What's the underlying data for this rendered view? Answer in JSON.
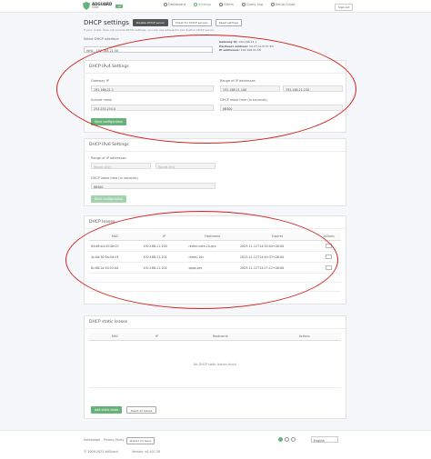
{
  "header": {
    "logo_name": "ADGUARD",
    "logo_sub": "HOME",
    "logo_badge": "v0",
    "nav": [
      {
        "label": "Dashboard",
        "active": false
      },
      {
        "label": "Settings",
        "active": true
      },
      {
        "label": "Filters",
        "active": false
      },
      {
        "label": "Query Log",
        "active": false
      },
      {
        "label": "Setup Guide",
        "active": false
      }
    ],
    "sign_out": "Sign out"
  },
  "page": {
    "title": "DHCP settings",
    "btn_disable": "Disable DHCP server",
    "btn_check": "Check for DHCP servers",
    "btn_reset": "Reset settings",
    "hint": "If your router does not provide DHCP settings, you can use AdGuard's own built-in DHCP server."
  },
  "interface": {
    "label": "Select DHCP interface",
    "selected": "eth0 - 192.168.21.58",
    "gateway_label": "Gateway IP:",
    "gateway_value": "192.168.21.1",
    "hw_label": "Hardware address:",
    "hw_value": "5d:27:ce:57:fc:63",
    "ip_label": "IP addresses:",
    "ip_value": "192.168.21.58"
  },
  "ipv4": {
    "title": "DHCP IPv4 Settings",
    "gateway_label": "Gateway IP",
    "gateway_value": "192.168.21.1",
    "range_label": "Range of IP addresses",
    "range_start": "192.168.21.100",
    "range_end": "192.168.21.230",
    "mask_label": "Subnet mask",
    "mask_value": "255.255.255.0",
    "lease_label": "DHCP lease time (in seconds)",
    "lease_value": "86400",
    "save": "Save configuration"
  },
  "ipv6": {
    "title": "DHCP IPv6 Settings",
    "range_label": "Range of IP addresses",
    "range_start_ph": "Range start",
    "range_end_ph": "Range end",
    "lease_label": "DHCP lease time (in seconds)",
    "lease_value": "86400",
    "save": "Save configuration"
  },
  "leases": {
    "title": "DHCP leases",
    "columns": [
      "MAC",
      "IP",
      "Hostname",
      "Expires",
      "Actions"
    ],
    "rows": [
      {
        "mac": "84:d8:b4:45:0b:07",
        "ip": "192.168.21.100",
        "host": "redmi-note-10-pro",
        "expires": "2023-11-12T14:30:04+08:00"
      },
      {
        "mac": "4c:0d:30:5a:5d:43",
        "ip": "192.168.21.101",
        "host": "redmi-10c",
        "expires": "2023-11-12T14:49:37+08:00"
      },
      {
        "mac": "8c:88:2a:50:52:00",
        "ip": "192.168.21.102",
        "host": "oppo-pro",
        "expires": "2023-11-12T14:27:12+08:00"
      }
    ]
  },
  "static": {
    "title": "DHCP static leases",
    "columns": [
      "MAC",
      "IP",
      "Hostname",
      "Actions"
    ],
    "empty": "No DHCP static leases found",
    "add": "Add static lease",
    "reset": "Reset all leases"
  },
  "footer": {
    "homepage": "Homepage",
    "privacy": "Privacy Policy",
    "report": "Report an issue",
    "copyright": "© 2009-2023 AdGuard",
    "version": "Version: v0.107.28",
    "language": "English"
  },
  "colors": {
    "accent": "#67b279",
    "annotation": "#d0241a"
  }
}
